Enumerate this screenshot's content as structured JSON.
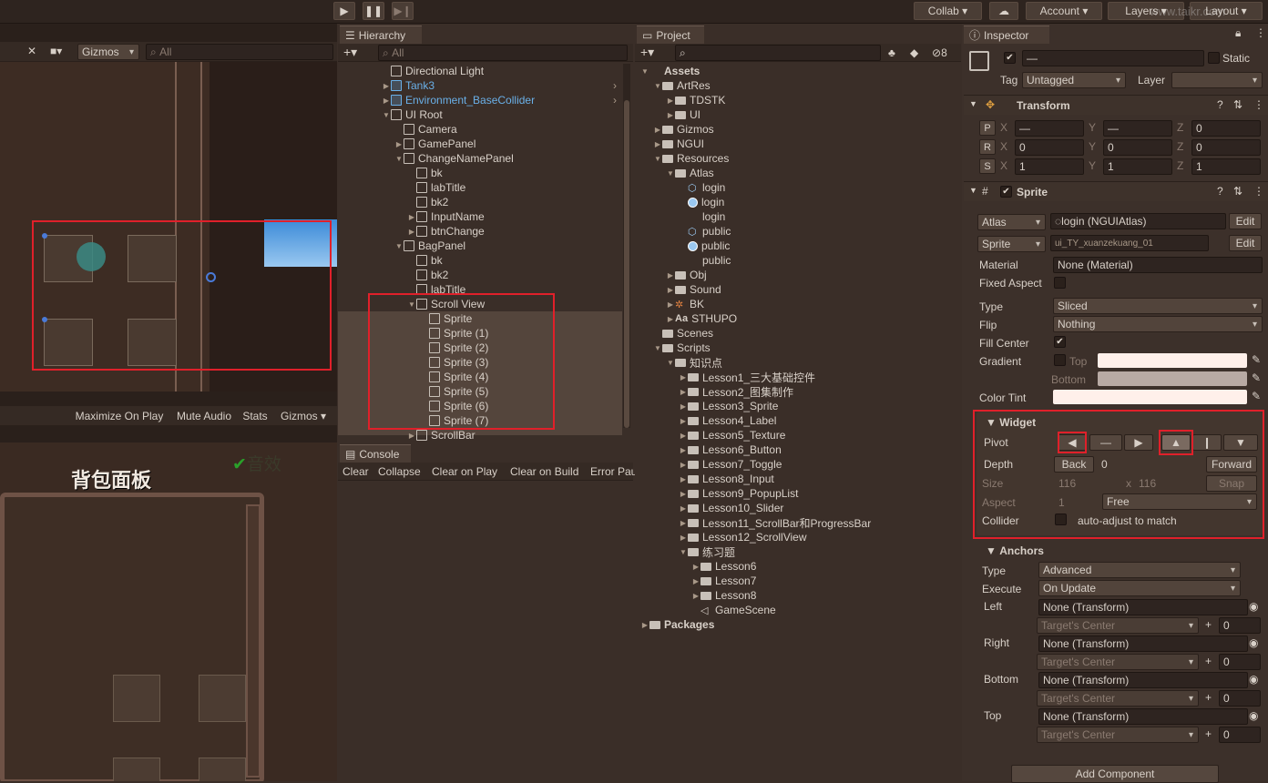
{
  "toolbar": {
    "collab": "Collab",
    "account": "Account",
    "layers": "Layers",
    "layout": "Layout",
    "watermark": "www.taikr.com"
  },
  "scene": {
    "gizmos": "Gizmos",
    "search_placeholder": "All"
  },
  "game": {
    "maximize": "Maximize On Play",
    "mute": "Mute Audio",
    "stats": "Stats",
    "gizmos": "Gizmos",
    "panel_title": "背包面板",
    "sound": "音效"
  },
  "hierarchy": {
    "tab": "Hierarchy",
    "search_placeholder": "All",
    "items": [
      {
        "label": "Directional Light",
        "indent": 0,
        "arrow": "",
        "blue": false
      },
      {
        "label": "Tank3",
        "indent": 0,
        "arrow": "▶",
        "blue": true
      },
      {
        "label": "Environment_BaseCollider",
        "indent": 0,
        "arrow": "▶",
        "blue": true
      },
      {
        "label": "UI Root",
        "indent": 0,
        "arrow": "▼",
        "blue": false
      },
      {
        "label": "Camera",
        "indent": 1,
        "arrow": "",
        "blue": false
      },
      {
        "label": "GamePanel",
        "indent": 1,
        "arrow": "▶",
        "blue": false
      },
      {
        "label": "ChangeNamePanel",
        "indent": 1,
        "arrow": "▼",
        "blue": false
      },
      {
        "label": "bk",
        "indent": 2,
        "arrow": "",
        "blue": false
      },
      {
        "label": "labTitle",
        "indent": 2,
        "arrow": "",
        "blue": false
      },
      {
        "label": "bk2",
        "indent": 2,
        "arrow": "",
        "blue": false
      },
      {
        "label": "InputName",
        "indent": 2,
        "arrow": "▶",
        "blue": false
      },
      {
        "label": "btnChange",
        "indent": 2,
        "arrow": "▶",
        "blue": false
      },
      {
        "label": "BagPanel",
        "indent": 1,
        "arrow": "▼",
        "blue": false
      },
      {
        "label": "bk",
        "indent": 2,
        "arrow": "",
        "blue": false
      },
      {
        "label": "bk2",
        "indent": 2,
        "arrow": "",
        "blue": false
      },
      {
        "label": "labTitle",
        "indent": 2,
        "arrow": "",
        "blue": false
      },
      {
        "label": "Scroll View",
        "indent": 2,
        "arrow": "▼",
        "blue": false
      },
      {
        "label": "Sprite",
        "indent": 3,
        "arrow": "",
        "blue": false
      },
      {
        "label": "Sprite (1)",
        "indent": 3,
        "arrow": "",
        "blue": false
      },
      {
        "label": "Sprite (2)",
        "indent": 3,
        "arrow": "",
        "blue": false
      },
      {
        "label": "Sprite (3)",
        "indent": 3,
        "arrow": "",
        "blue": false
      },
      {
        "label": "Sprite (4)",
        "indent": 3,
        "arrow": "",
        "blue": false
      },
      {
        "label": "Sprite (5)",
        "indent": 3,
        "arrow": "",
        "blue": false
      },
      {
        "label": "Sprite (6)",
        "indent": 3,
        "arrow": "",
        "blue": false
      },
      {
        "label": "Sprite (7)",
        "indent": 3,
        "arrow": "",
        "blue": false
      },
      {
        "label": "ScrollBar",
        "indent": 2,
        "arrow": "▶",
        "blue": false
      }
    ]
  },
  "console": {
    "tab": "Console",
    "clear": "Clear",
    "collapse": "Collapse",
    "clear_on_play": "Clear on Play",
    "clear_on_build": "Clear on Build",
    "error_pause": "Error Pau"
  },
  "project": {
    "tab": "Project",
    "badge": "8",
    "items": [
      {
        "label": "Assets",
        "indent": 0,
        "arrow": "▼",
        "icon": "none",
        "bold": true
      },
      {
        "label": "ArtRes",
        "indent": 1,
        "arrow": "▼",
        "icon": "folder"
      },
      {
        "label": "TDSTK",
        "indent": 2,
        "arrow": "▶",
        "icon": "folder"
      },
      {
        "label": "UI",
        "indent": 2,
        "arrow": "▶",
        "icon": "folder"
      },
      {
        "label": "Gizmos",
        "indent": 1,
        "arrow": "▶",
        "icon": "folder"
      },
      {
        "label": "NGUI",
        "indent": 1,
        "arrow": "▶",
        "icon": "folder"
      },
      {
        "label": "Resources",
        "indent": 1,
        "arrow": "▼",
        "icon": "folder"
      },
      {
        "label": "Atlas",
        "indent": 2,
        "arrow": "▼",
        "icon": "folder"
      },
      {
        "label": "login",
        "indent": 3,
        "arrow": "",
        "icon": "asset"
      },
      {
        "label": "login",
        "indent": 3,
        "arrow": "",
        "icon": "material"
      },
      {
        "label": "login",
        "indent": 3,
        "arrow": "",
        "icon": "none"
      },
      {
        "label": "public",
        "indent": 3,
        "arrow": "",
        "icon": "asset"
      },
      {
        "label": "public",
        "indent": 3,
        "arrow": "",
        "icon": "material"
      },
      {
        "label": "public",
        "indent": 3,
        "arrow": "",
        "icon": "none"
      },
      {
        "label": "Obj",
        "indent": 2,
        "arrow": "▶",
        "icon": "folder"
      },
      {
        "label": "Sound",
        "indent": 2,
        "arrow": "▶",
        "icon": "folder"
      },
      {
        "label": "BK",
        "indent": 2,
        "arrow": "▶",
        "icon": "img"
      },
      {
        "label": "STHUPO",
        "indent": 2,
        "arrow": "▶",
        "icon": "font"
      },
      {
        "label": "Scenes",
        "indent": 1,
        "arrow": "",
        "icon": "folder"
      },
      {
        "label": "Scripts",
        "indent": 1,
        "arrow": "▼",
        "icon": "folder"
      },
      {
        "label": "知识点",
        "indent": 2,
        "arrow": "▼",
        "icon": "folder"
      },
      {
        "label": "Lesson1_三大基础控件",
        "indent": 3,
        "arrow": "▶",
        "icon": "folder"
      },
      {
        "label": "Lesson2_图集制作",
        "indent": 3,
        "arrow": "▶",
        "icon": "folder"
      },
      {
        "label": "Lesson3_Sprite",
        "indent": 3,
        "arrow": "▶",
        "icon": "folder"
      },
      {
        "label": "Lesson4_Label",
        "indent": 3,
        "arrow": "▶",
        "icon": "folder"
      },
      {
        "label": "Lesson5_Texture",
        "indent": 3,
        "arrow": "▶",
        "icon": "folder"
      },
      {
        "label": "Lesson6_Button",
        "indent": 3,
        "arrow": "▶",
        "icon": "folder"
      },
      {
        "label": "Lesson7_Toggle",
        "indent": 3,
        "arrow": "▶",
        "icon": "folder"
      },
      {
        "label": "Lesson8_Input",
        "indent": 3,
        "arrow": "▶",
        "icon": "folder"
      },
      {
        "label": "Lesson9_PopupList",
        "indent": 3,
        "arrow": "▶",
        "icon": "folder"
      },
      {
        "label": "Lesson10_Slider",
        "indent": 3,
        "arrow": "▶",
        "icon": "folder"
      },
      {
        "label": "Lesson11_ScrollBar和ProgressBar",
        "indent": 3,
        "arrow": "▶",
        "icon": "folder"
      },
      {
        "label": "Lesson12_ScrollView",
        "indent": 3,
        "arrow": "▶",
        "icon": "folder"
      },
      {
        "label": "练习题",
        "indent": 3,
        "arrow": "▼",
        "icon": "folder"
      },
      {
        "label": "Lesson6",
        "indent": 4,
        "arrow": "▶",
        "icon": "folder"
      },
      {
        "label": "Lesson7",
        "indent": 4,
        "arrow": "▶",
        "icon": "folder"
      },
      {
        "label": "Lesson8",
        "indent": 4,
        "arrow": "▶",
        "icon": "folder"
      },
      {
        "label": "GameScene",
        "indent": 4,
        "arrow": "",
        "icon": "scene"
      },
      {
        "label": "Packages",
        "indent": 0,
        "arrow": "▶",
        "icon": "folder",
        "bold": true
      }
    ]
  },
  "inspector": {
    "tab": "Inspector",
    "name": "—",
    "static": "Static",
    "tag_label": "Tag",
    "tag": "Untagged",
    "layer_label": "Layer",
    "layer": "",
    "transform": {
      "title": "Transform",
      "p": [
        "—",
        "—",
        "0"
      ],
      "r": [
        "0",
        "0",
        "0"
      ],
      "s": [
        "1",
        "1",
        "1"
      ]
    },
    "sprite": {
      "title": "Sprite",
      "atlas_label": "Atlas",
      "atlas": "login (NGUIAtlas)",
      "edit": "Edit",
      "sprite_label": "Sprite",
      "sprite": "ui_TY_xuanzekuang_01",
      "material_label": "Material",
      "material": "None (Material)",
      "fixed_aspect": "Fixed Aspect",
      "type_label": "Type",
      "type": "Sliced",
      "flip_label": "Flip",
      "flip": "Nothing",
      "fill_center": "Fill Center",
      "gradient": "Gradient",
      "top": "Top",
      "bottom": "Bottom",
      "color_tint": "Color Tint"
    },
    "widget": {
      "title": "Widget",
      "pivot": "Pivot",
      "depth": "Depth",
      "back": "Back",
      "depth_value": "0",
      "forward": "Forward",
      "size": "Size",
      "w": "116",
      "x": "x",
      "h": "116",
      "snap": "Snap",
      "aspect": "Aspect",
      "aspect_value": "1",
      "aspect_mode": "Free",
      "collider": "Collider",
      "collider_text": "auto-adjust to match"
    },
    "anchors": {
      "title": "Anchors",
      "type_label": "Type",
      "type": "Advanced",
      "execute_label": "Execute",
      "execute": "On Update",
      "rows": [
        {
          "label": "Left",
          "target": "None (Transform)",
          "center": "Target's Center",
          "offset": "0"
        },
        {
          "label": "Right",
          "target": "None (Transform)",
          "center": "Target's Center",
          "offset": "0"
        },
        {
          "label": "Bottom",
          "target": "None (Transform)",
          "center": "Target's Center",
          "offset": "0"
        },
        {
          "label": "Top",
          "target": "None (Transform)",
          "center": "Target's Center",
          "offset": "0"
        }
      ]
    },
    "add_component": "Add Component"
  },
  "colors": {
    "accent_red": "#e0202a",
    "selection": "#5a4a40",
    "link_blue": "#6ab0e8"
  }
}
